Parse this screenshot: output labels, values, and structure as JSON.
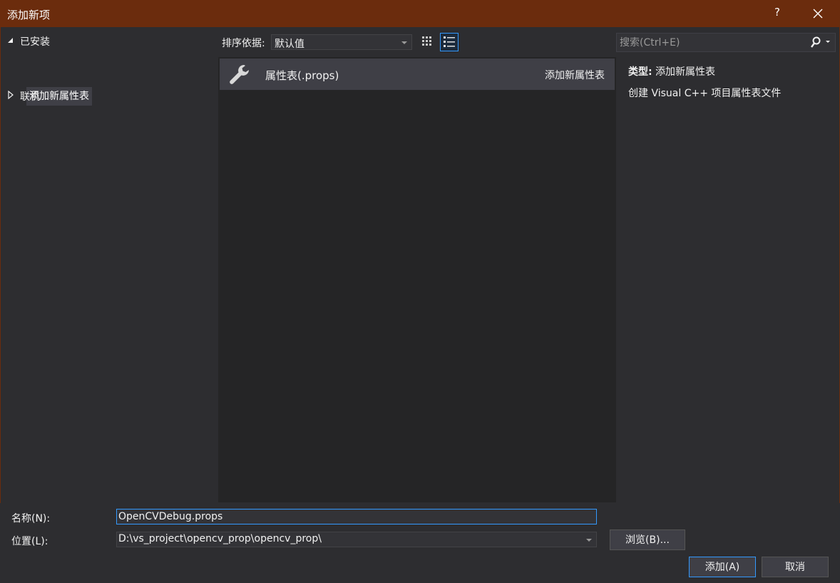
{
  "window": {
    "title": "添加新项",
    "help_label": "?",
    "close_icon": "close-icon"
  },
  "tree": {
    "installed": "已安装",
    "selected_item": "添加新属性表",
    "online": "联机"
  },
  "toolbar": {
    "sort_label": "排序依据:",
    "sort_value": "默认值",
    "view_small_icon": "grid-view-icon",
    "view_list_icon": "list-view-icon"
  },
  "search": {
    "placeholder": "搜索(Ctrl+E)",
    "icon": "search-icon"
  },
  "items": [
    {
      "icon": "wrench-icon",
      "name": "属性表(.props)",
      "category": "添加新属性表"
    }
  ],
  "details": {
    "type_label": "类型:",
    "type_value": "添加新属性表",
    "description": "创建 Visual C++ 项目属性表文件"
  },
  "form": {
    "name_label": "名称(N):",
    "name_value": "OpenCVDebug.props",
    "location_label": "位置(L):",
    "location_value": "D:\\vs_project\\opencv_prop\\opencv_prop\\",
    "browse_label": "浏览(B)...",
    "add_label": "添加(A)",
    "cancel_label": "取消"
  },
  "colors": {
    "titlebar": "#6b2c0d",
    "background": "#2d2d30",
    "list_background": "#252526",
    "selection": "#3f3f46",
    "accent": "#3399ff"
  }
}
